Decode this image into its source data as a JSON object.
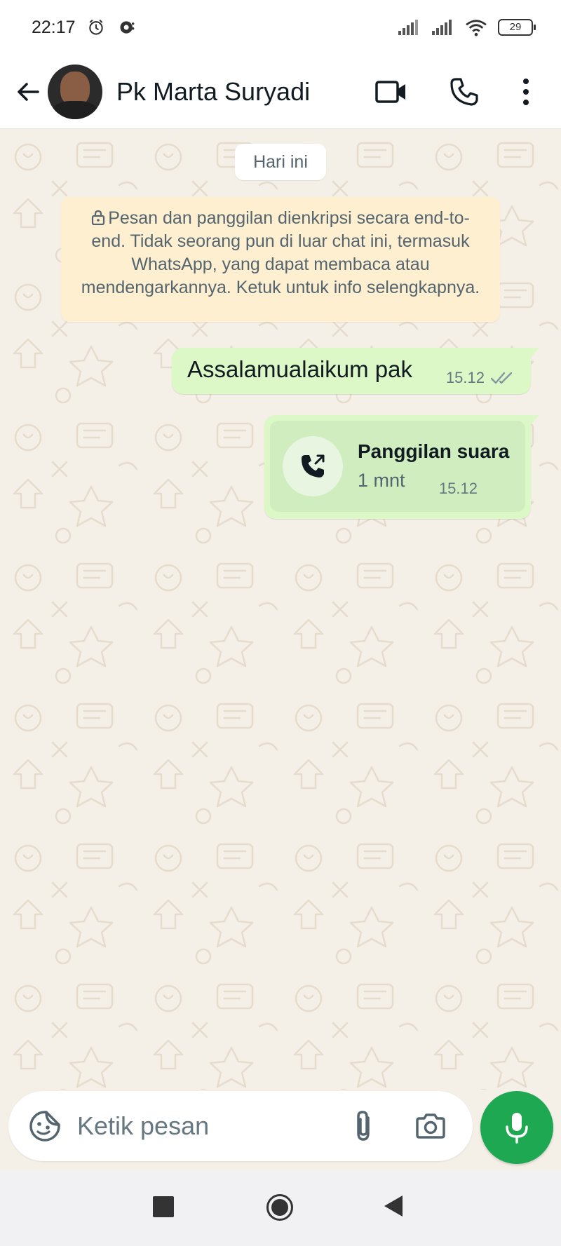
{
  "status_bar": {
    "time": "22:17",
    "battery": "29",
    "icons": [
      "alarm-icon",
      "notification-icon",
      "signal-icon",
      "signal-icon",
      "wifi-icon",
      "battery-icon"
    ]
  },
  "header": {
    "contact_name": "Pk Marta Suryadi",
    "icons": [
      "back-arrow-icon",
      "video-call-icon",
      "phone-icon",
      "more-vertical-icon"
    ]
  },
  "chat": {
    "date_chip": "Hari ini",
    "encryption_notice": "Pesan dan panggilan dienkripsi secara end-to-end. Tidak seorang pun di luar chat ini, termasuk WhatsApp, yang dapat membaca atau mendengarkannya. Ketuk untuk info selengkapnya.",
    "messages": [
      {
        "type": "text",
        "direction": "outgoing",
        "text": "Assalamualaikum pak",
        "time": "15.12",
        "status": "read"
      },
      {
        "type": "call",
        "direction": "outgoing",
        "title": "Panggilan suara",
        "duration": "1 mnt",
        "time": "15.12"
      }
    ]
  },
  "input": {
    "placeholder": "Ketik pesan",
    "value": ""
  },
  "colors": {
    "accent": "#1da851",
    "outgoing_bubble": "#dcf8c6",
    "chat_background": "#f4efe7",
    "notice_background": "#fdefd0"
  }
}
